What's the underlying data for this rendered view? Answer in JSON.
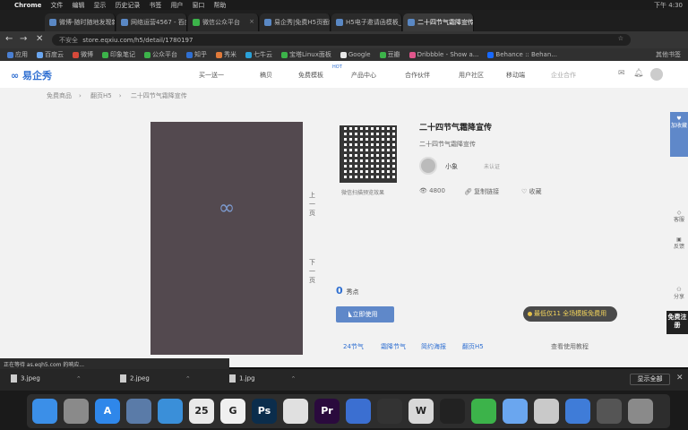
{
  "menubar": {
    "apple": "",
    "app": "Chrome",
    "items": [
      "文件",
      "编辑",
      "显示",
      "历史记录",
      "书签",
      "用户",
      "窗口",
      "帮助"
    ],
    "right": "下午 4:30"
  },
  "tabs": [
    {
      "label": "微博-随时随地发现新鲜事",
      "active": false
    },
    {
      "label": "网络运营4567 - 百度脑图",
      "active": false
    },
    {
      "label": "微信公众平台",
      "active": false
    },
    {
      "label": "易企秀|免费H5页面制作",
      "active": false
    },
    {
      "label": "H5电子邀请函模板_海报",
      "active": false
    },
    {
      "label": "二十四节气霜降宣传免费",
      "active": true
    }
  ],
  "toolbar": {
    "back": "←",
    "forward": "→",
    "stop": "✕",
    "secure_label": "不安全",
    "url": "store.eqxiu.com/h5/detail/1780197",
    "star": "☆"
  },
  "bookmarks": {
    "items": [
      "应用",
      "百度云",
      "微博",
      "印象笔记",
      "公众平台",
      "知乎",
      "秀米",
      "七牛云",
      "宝塔Linux面板",
      "Google",
      "豆瓣",
      "Dribbble - Show a...",
      "Behance :: Behan..."
    ],
    "other": "其他书签"
  },
  "site": {
    "logo": "易企秀",
    "nav": [
      "买一送一",
      "稿贝",
      "免费模板",
      "产品中心",
      "合作伙伴",
      "用户社区",
      "移动端",
      "企业合作"
    ],
    "nav_badge": "HOT",
    "crumbs": [
      "免费商品",
      "翻页H5",
      "二十四节气霜降宣传"
    ],
    "prev_label": "上一页",
    "next_label": "下一页",
    "qr_caption": "微信扫描预览效果",
    "title": "二十四节气霜降宣传",
    "subtitle": "二十四节气霜降宣传",
    "author": "小象",
    "auth_badge": "未认证",
    "stats": {
      "views": "4800",
      "report": "复制链接",
      "fav": "收藏"
    },
    "price_value": "0",
    "price_unit": "秀点",
    "use_button": "立即使用",
    "promo": "最低仅11 全场模板免费用",
    "tags": [
      "24节气",
      "霜降节气",
      "简约海报",
      "翻页H5"
    ],
    "help": "查看使用教程",
    "side_fav": "加收藏",
    "side_items": [
      "客服",
      "反馈",
      "分享"
    ],
    "side_cta": "免费注册"
  },
  "statusbar": "正在等待 as.eqh5.com 的响应...",
  "downloads": {
    "files": [
      "3.jpeg",
      "2.jpeg",
      "1.jpg"
    ],
    "show_all": "显示全部",
    "close": "✕"
  },
  "dock": {
    "apps": [
      {
        "name": "finder",
        "label": "",
        "color": "#3b8fe8"
      },
      {
        "name": "launchpad",
        "label": "",
        "color": "#8a8a8a"
      },
      {
        "name": "app-store",
        "label": "A",
        "color": "#2f87ea"
      },
      {
        "name": "preview",
        "label": "",
        "color": "#5a7ba8"
      },
      {
        "name": "safari",
        "label": "",
        "color": "#3a8fd9"
      },
      {
        "name": "calendar",
        "label": "25",
        "color": "#e9e9e9"
      },
      {
        "name": "google",
        "label": "G",
        "color": "#f0f0f0"
      },
      {
        "name": "photoshop",
        "label": "Ps",
        "color": "#0b2d4c"
      },
      {
        "name": "chrome",
        "label": "",
        "color": "#e0e0e0"
      },
      {
        "name": "premiere",
        "label": "Pr",
        "color": "#2a0a3d"
      },
      {
        "name": "keynote",
        "label": "",
        "color": "#3b6fd1"
      },
      {
        "name": "terminal",
        "label": "",
        "color": "#333333"
      },
      {
        "name": "wps",
        "label": "W",
        "color": "#d8d8d8"
      },
      {
        "name": "qq",
        "label": "",
        "color": "#222222"
      },
      {
        "name": "wechat",
        "label": "",
        "color": "#3cb34a"
      },
      {
        "name": "baidu-netdisk",
        "label": "",
        "color": "#6aa6ef"
      },
      {
        "name": "notes",
        "label": "",
        "color": "#c9c9c9"
      },
      {
        "name": "baidu-cloud",
        "label": "",
        "color": "#3f7cd8"
      },
      {
        "name": "quicktime",
        "label": "",
        "color": "#555555"
      },
      {
        "name": "trash",
        "label": "",
        "color": "#8a8a8a"
      }
    ]
  }
}
